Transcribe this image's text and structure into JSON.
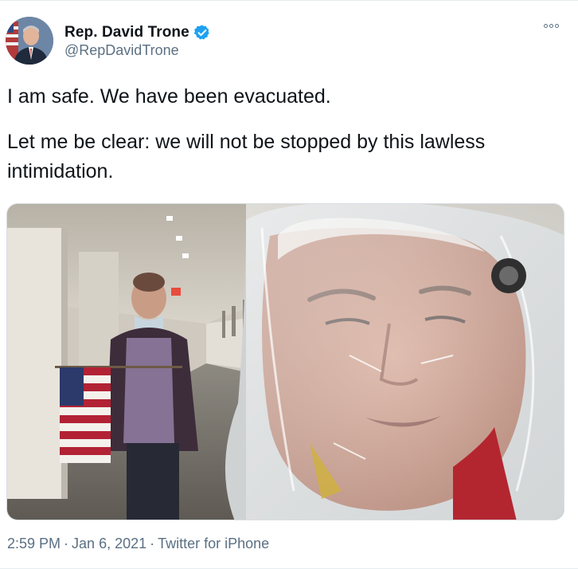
{
  "author": {
    "display_name": "Rep. David Trone",
    "handle": "@RepDavidTrone",
    "verified": true,
    "avatar_icon": "profile-photo"
  },
  "tweet": {
    "paragraphs": [
      "I am safe. We have been evacuated.",
      "Let me be clear: we will not be stopped by this lawless intimidation."
    ]
  },
  "meta": {
    "time": "2:59 PM",
    "separator": "·",
    "date": "Jan 6, 2021",
    "source": "Twitter for iPhone"
  },
  "colors": {
    "verified_badge": "#1da1f2",
    "secondary_text": "#5b7083"
  }
}
